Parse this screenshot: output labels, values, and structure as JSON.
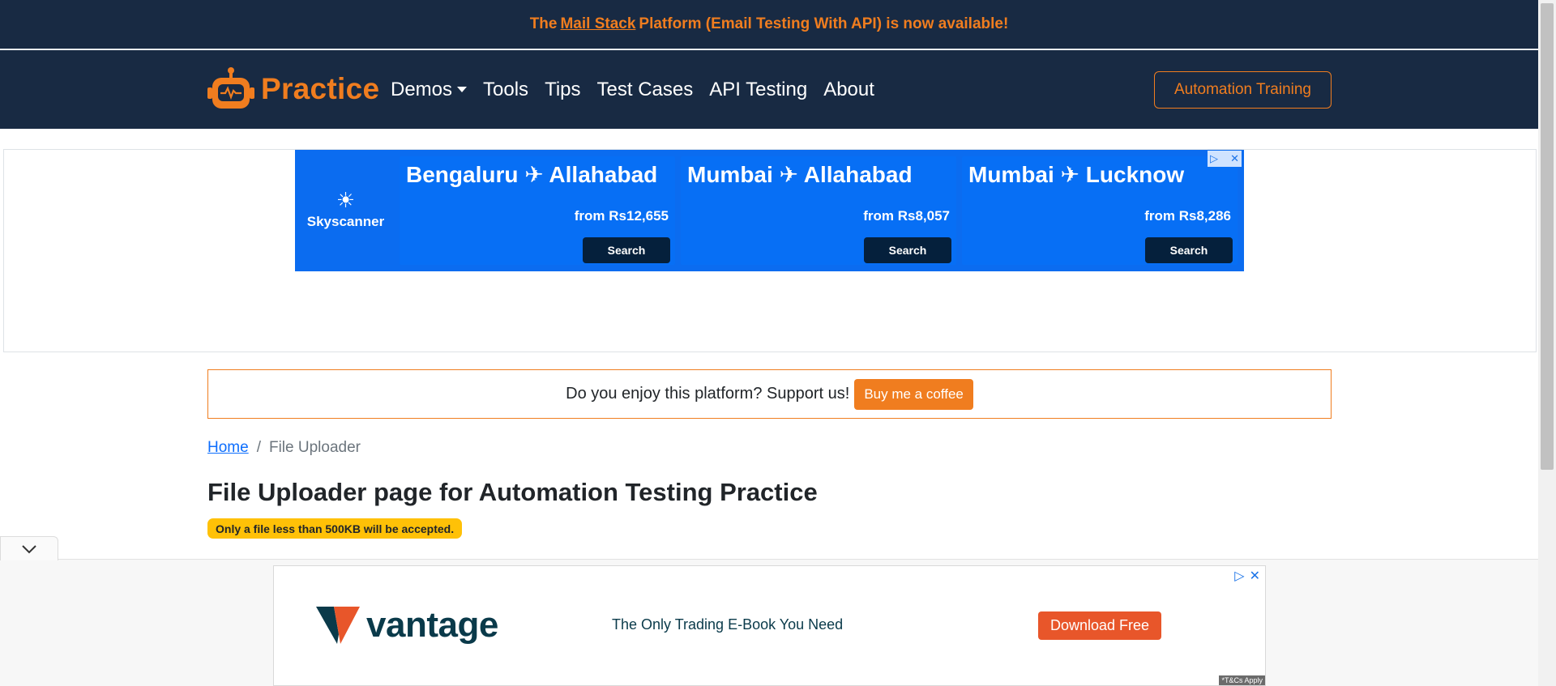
{
  "announcement": {
    "prefix": "The ",
    "link": "Mail Stack",
    "suffix": " Platform (Email Testing With API) is now available!"
  },
  "navbar": {
    "brand": "Practice",
    "links": [
      "Demos",
      "Tools",
      "Tips",
      "Test Cases",
      "API Testing",
      "About"
    ],
    "cta": "Automation Training"
  },
  "top_ad": {
    "brand": "Skyscanner",
    "panels": [
      {
        "route": "Bengaluru ✈ Allahabad",
        "price": "from Rs12,655",
        "button": "Search"
      },
      {
        "route": "Mumbai ✈ Allahabad",
        "price": "from Rs8,057",
        "button": "Search"
      },
      {
        "route": "Mumbai ✈ Lucknow",
        "price": "from Rs8,286",
        "button": "Search"
      }
    ]
  },
  "support": {
    "text": "Do you enjoy this platform? Support us!",
    "button": "Buy me a coffee"
  },
  "breadcrumb": {
    "home": "Home",
    "separator": "/",
    "current": "File Uploader"
  },
  "page": {
    "title": "File Uploader page for Automation Testing Practice",
    "badge": "Only a file less than 500KB will be accepted."
  },
  "bottom_ad": {
    "brand": "vantage",
    "tagline": "The Only Trading E-Book You Need",
    "button": "Download Free",
    "tcs": "*T&Cs Apply"
  },
  "colors": {
    "navy": "#182a43",
    "orange": "#f07d1f",
    "sky_blue": "#0b6cf0",
    "badge_yellow": "#ffc107"
  }
}
